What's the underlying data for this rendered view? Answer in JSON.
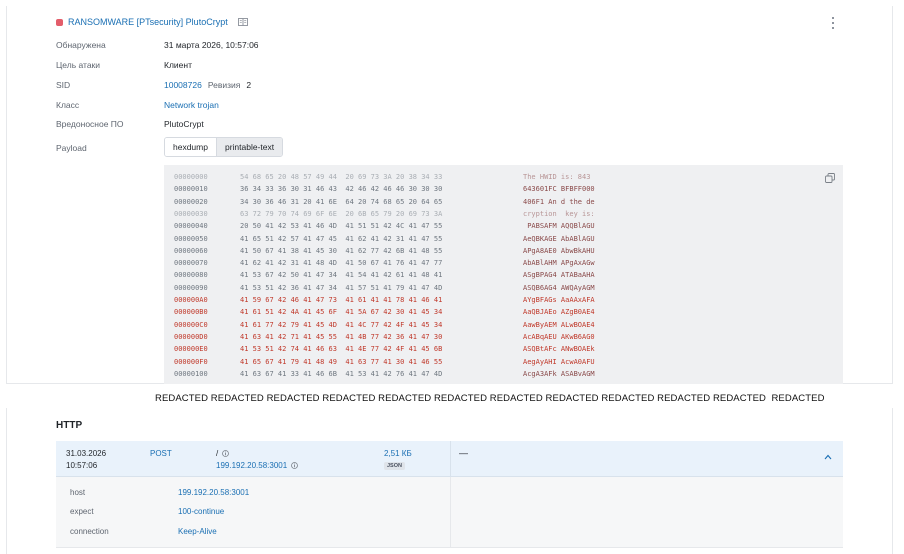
{
  "alert": {
    "title": "RANSOMWARE [PTsecurity] PlutoCrypt",
    "severity_color": "#e35d6a",
    "fields": {
      "detected": {
        "label": "Обнаружена",
        "value": "31 марта 2026, 10:57:06"
      },
      "target": {
        "label": "Цель атаки",
        "value": "Клиент"
      },
      "sid": {
        "label": "SID",
        "value": "10008726",
        "revision_label": "Ревизия",
        "revision_value": "2"
      },
      "class": {
        "label": "Класс",
        "value": "Network trojan"
      },
      "malware": {
        "label": "Вредоносное ПО",
        "value": "PlutoCrypt"
      },
      "payload": {
        "label": "Payload"
      }
    }
  },
  "payload_view": {
    "tabs": [
      "hexdump",
      "printable-text"
    ],
    "active_tab": "hexdump"
  },
  "hexdump": {
    "rows": [
      {
        "offset": "00000000",
        "bytes": "54 68 65 20 48 57 49 44  20 69 73 3A 20 38 34 33",
        "ascii": "The HWID is: 843",
        "highlight": false,
        "faded": true
      },
      {
        "offset": "00000010",
        "bytes": "36 34 33 36 30 31 46 43  42 46 42 46 46 30 30 30",
        "ascii": "643601FC BFBFF000",
        "highlight": false,
        "faded": false
      },
      {
        "offset": "00000020",
        "bytes": "34 30 36 46 31 20 41 6E  64 20 74 68 65 20 64 65",
        "ascii": "406F1 An d the de",
        "highlight": false,
        "faded": false
      },
      {
        "offset": "00000030",
        "bytes": "63 72 79 70 74 69 6F 6E  20 6B 65 79 20 69 73 3A",
        "ascii": "cryption  key is:",
        "highlight": false,
        "faded": true
      },
      {
        "offset": "00000040",
        "bytes": "20 50 41 42 53 41 46 4D  41 51 51 42 4C 41 47 55",
        "ascii": " PABSAFM AQQBlAGU",
        "highlight": false,
        "faded": false
      },
      {
        "offset": "00000050",
        "bytes": "41 65 51 42 57 41 47 45  41 62 41 42 31 41 47 55",
        "ascii": "AeQBKAGE AbABlAGU",
        "highlight": false,
        "faded": false
      },
      {
        "offset": "00000060",
        "bytes": "41 50 67 41 38 41 45 30  41 62 77 42 6B 41 48 55",
        "ascii": "APgA8AE0 AbwBkAHU",
        "highlight": false,
        "faded": false
      },
      {
        "offset": "00000070",
        "bytes": "41 62 41 42 31 41 48 4D  41 50 67 41 76 41 47 77",
        "ascii": "AbABlAHM APgAxAGw",
        "highlight": false,
        "faded": false
      },
      {
        "offset": "00000080",
        "bytes": "41 53 67 42 50 41 47 34  41 54 41 42 61 41 48 41",
        "ascii": "ASgBPAG4 ATABaAHA",
        "highlight": false,
        "faded": false
      },
      {
        "offset": "00000090",
        "bytes": "41 53 51 42 36 41 47 34  41 57 51 41 79 41 47 4D",
        "ascii": "ASQB6AG4 AWQAyAGM",
        "highlight": false,
        "faded": false
      },
      {
        "offset": "000000A0",
        "bytes": "41 59 67 42 46 41 47 73  41 61 41 41 78 41 46 41",
        "ascii": "AYgBFAGs AaAAxAFA",
        "highlight": true,
        "faded": false
      },
      {
        "offset": "000000B0",
        "bytes": "41 61 51 42 4A 41 45 6F  41 5A 67 42 30 41 45 34",
        "ascii": "AaQBJAEo AZgB0AE4",
        "highlight": true,
        "faded": false
      },
      {
        "offset": "000000C0",
        "bytes": "41 61 77 42 79 41 45 4D  41 4C 77 42 4F 41 45 34",
        "ascii": "AawByAEM ALwBOAE4",
        "highlight": true,
        "faded": false
      },
      {
        "offset": "000000D0",
        "bytes": "41 63 41 42 71 41 45 55  41 4B 77 42 36 41 47 30",
        "ascii": "AcABqAEU AKwB6AG0",
        "highlight": true,
        "faded": false
      },
      {
        "offset": "000000E0",
        "bytes": "41 53 51 42 74 41 46 63  41 4E 77 42 4F 41 45 6B",
        "ascii": "ASQBtAFc ANwBOAEk",
        "highlight": true,
        "faded": false
      },
      {
        "offset": "000000F0",
        "bytes": "41 65 67 41 79 41 48 49  41 63 77 41 30 41 46 55",
        "ascii": "AegAyAHI AcwA0AFU",
        "highlight": true,
        "faded": false
      },
      {
        "offset": "00000100",
        "bytes": "41 63 67 41 33 41 46 6B  41 53 41 42 76 41 47 4D",
        "ascii": "AcgA3AFk ASABvAGM",
        "highlight": false,
        "faded": false
      }
    ]
  },
  "redacted_text": "REDACTED REDACTED REDACTED REDACTED REDACTED REDACTED REDACTED REDACTED REDACTED REDACTED REDACTED  REDACTED",
  "http": {
    "title": "HTTP",
    "request": {
      "date": "31.03.2026",
      "time": "10:57:06",
      "method": "POST",
      "path": "/",
      "host_addr": "199.192.20.58:3001",
      "size": "2,51 КБ",
      "format": "JSON",
      "response": "—"
    },
    "headers": [
      {
        "key": "host",
        "value": "199.192.20.58:3001"
      },
      {
        "key": "expect",
        "value": "100-continue"
      },
      {
        "key": "connection",
        "value": "Keep-Alive"
      }
    ]
  },
  "colors": {
    "link": "#1a6fb3",
    "hex_normal": "#6f7780",
    "hex_highlight": "#c0392b",
    "ascii_normal": "#8a4a4a",
    "panel_bg": "#eff0f2",
    "http_header_bg": "#e9f2fb"
  }
}
